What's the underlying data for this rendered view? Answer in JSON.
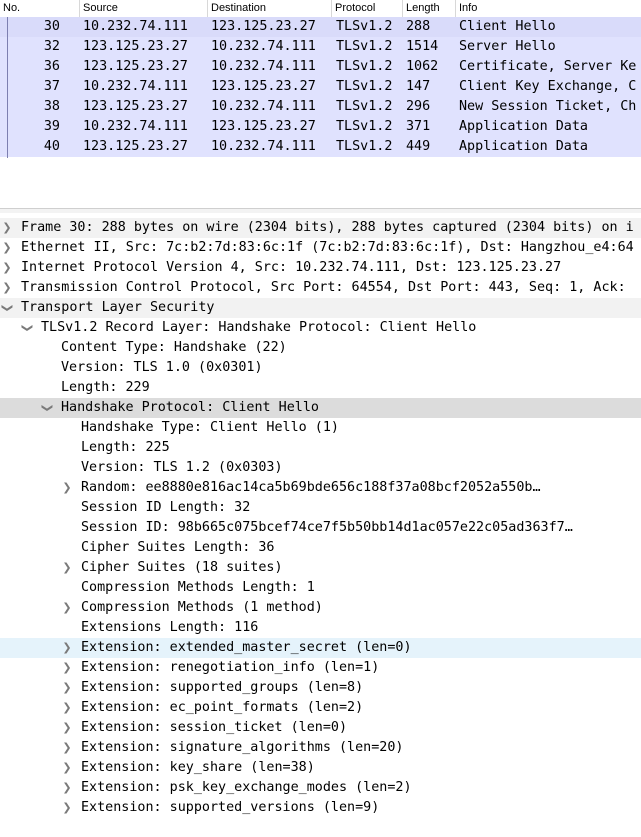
{
  "packet_list": {
    "columns": {
      "no": "No.",
      "source": "Source",
      "destination": "Destination",
      "protocol": "Protocol",
      "length": "Length",
      "info": "Info"
    },
    "rows": [
      {
        "no": "30",
        "source": "10.232.74.111",
        "destination": "123.125.23.27",
        "protocol": "TLSv1.2",
        "length": "288",
        "info": "Client Hello"
      },
      {
        "no": "32",
        "source": "123.125.23.27",
        "destination": "10.232.74.111",
        "protocol": "TLSv1.2",
        "length": "1514",
        "info": "Server Hello"
      },
      {
        "no": "36",
        "source": "123.125.23.27",
        "destination": "10.232.74.111",
        "protocol": "TLSv1.2",
        "length": "1062",
        "info": "Certificate, Server Ke"
      },
      {
        "no": "37",
        "source": "10.232.74.111",
        "destination": "123.125.23.27",
        "protocol": "TLSv1.2",
        "length": "147",
        "info": "Client Key Exchange, C"
      },
      {
        "no": "38",
        "source": "123.125.23.27",
        "destination": "10.232.74.111",
        "protocol": "TLSv1.2",
        "length": "296",
        "info": "New Session Ticket, Ch"
      },
      {
        "no": "39",
        "source": "10.232.74.111",
        "destination": "123.125.23.27",
        "protocol": "TLSv1.2",
        "length": "371",
        "info": "Application Data"
      },
      {
        "no": "40",
        "source": "123.125.23.27",
        "destination": "10.232.74.111",
        "protocol": "TLSv1.2",
        "length": "449",
        "info": "Application Data"
      }
    ]
  },
  "details": {
    "frame": "Frame 30: 288 bytes on wire (2304 bits), 288 bytes captured (2304 bits) on i",
    "ethernet": "Ethernet II, Src: 7c:b2:7d:83:6c:1f (7c:b2:7d:83:6c:1f), Dst: Hangzhou_e4:64",
    "ip": "Internet Protocol Version 4, Src: 10.232.74.111, Dst: 123.125.23.27",
    "tcp": "Transmission Control Protocol, Src Port: 64554, Dst Port: 443, Seq: 1, Ack: ",
    "tls": "Transport Layer Security",
    "record_layer": "TLSv1.2 Record Layer: Handshake Protocol: Client Hello",
    "content_type": "Content Type: Handshake (22)",
    "version": "Version: TLS 1.0 (0x0301)",
    "length": "Length: 229",
    "handshake": "Handshake Protocol: Client Hello",
    "handshake_type": "Handshake Type: Client Hello (1)",
    "hs_length": "Length: 225",
    "hs_version": "Version: TLS 1.2 (0x0303)",
    "random": "Random: ee8880e816ac14ca5b69bde656c188f37a08bcf2052a550b…",
    "session_id_length": "Session ID Length: 32",
    "session_id": "Session ID: 98b665c075bcef74ce7f5b50bb14d1ac057e22c05ad363f7…",
    "cipher_suites_length": "Cipher Suites Length: 36",
    "cipher_suites": "Cipher Suites (18 suites)",
    "compression_methods_length": "Compression Methods Length: 1",
    "compression_methods": "Compression Methods (1 method)",
    "extensions_length": "Extensions Length: 116",
    "ext_extended_master_secret": "Extension: extended_master_secret (len=0)",
    "ext_renegotiation_info": "Extension: renegotiation_info (len=1)",
    "ext_supported_groups": "Extension: supported_groups (len=8)",
    "ext_ec_point_formats": "Extension: ec_point_formats (len=2)",
    "ext_session_ticket": "Extension: session_ticket (len=0)",
    "ext_signature_algorithms": "Extension: signature_algorithms (len=20)",
    "ext_key_share": "Extension: key_share (len=38)",
    "ext_psk_key_exchange_modes": "Extension: psk_key_exchange_modes (len=2)",
    "ext_supported_versions": "Extension: supported_versions (len=9)"
  },
  "icons": {
    "collapsed": "chevron-right-icon",
    "expanded": "chevron-down-icon"
  },
  "colors": {
    "row_bg": "#e0e2fe",
    "selected_detail": "#dcdcdc",
    "hover_detail": "#e5f3fb"
  }
}
